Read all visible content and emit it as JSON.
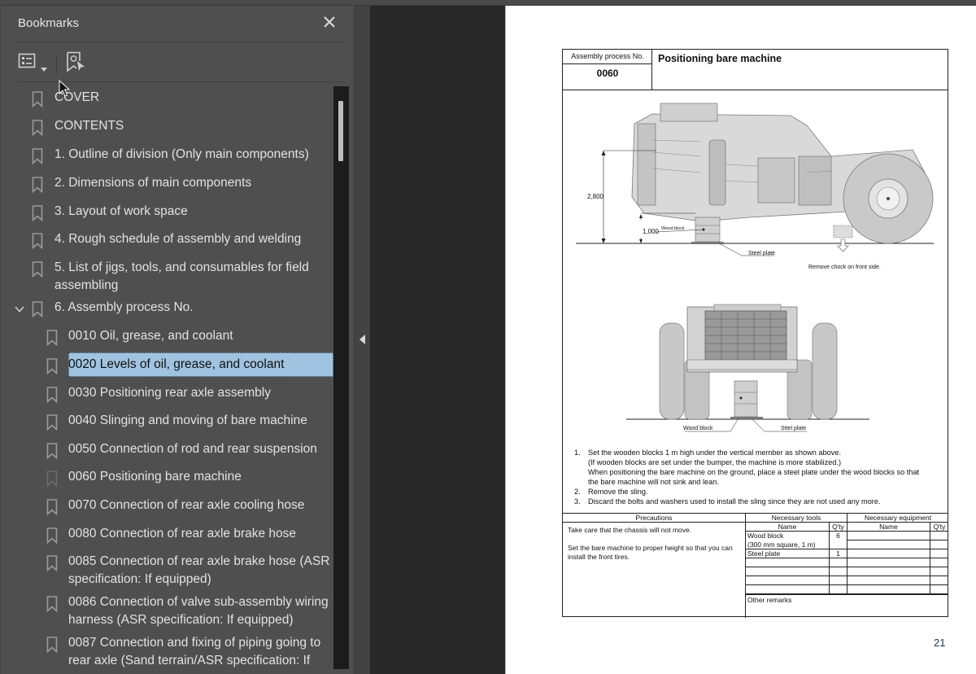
{
  "panel": {
    "title": "Bookmarks",
    "close_icon": "close-icon",
    "toolbar": {
      "options_icon": "list-options-icon",
      "options_dropdown_icon": "chevron-down-icon",
      "find_bookmark_icon": "find-current-bookmark-icon"
    }
  },
  "bookmarks": [
    {
      "label": "COVER",
      "level": 0
    },
    {
      "label": "CONTENTS",
      "level": 0
    },
    {
      "label": "1. Outline of division (Only main components)",
      "level": 0
    },
    {
      "label": "2. Dimensions of main components",
      "level": 0
    },
    {
      "label": "3. Layout of work space",
      "level": 0
    },
    {
      "label": "4. Rough schedule of assembly and welding",
      "level": 0
    },
    {
      "label": "5. List of jigs, tools, and consumables for field assembling",
      "level": 0
    },
    {
      "label": "6. Assembly process No.",
      "level": 0,
      "expanded": true
    },
    {
      "label": "0010 Oil, grease, and coolant",
      "level": 1
    },
    {
      "label": "0020 Levels of oil, grease, and coolant",
      "level": 1,
      "selected": true
    },
    {
      "label": "0030 Positioning rear axle assembly",
      "level": 1
    },
    {
      "label": "0040 Slinging and moving of bare machine",
      "level": 1
    },
    {
      "label": "0050 Connection of rod and rear suspension",
      "level": 1
    },
    {
      "label": "0060 Positioning bare machine",
      "level": 1,
      "current": true
    },
    {
      "label": "0070 Connection of rear axle cooling hose",
      "level": 1
    },
    {
      "label": "0080 Connection of rear axle brake hose",
      "level": 1
    },
    {
      "label": "0085 Connection of rear axle brake hose (ASR specification: If equipped)",
      "level": 1
    },
    {
      "label": "0086 Connection of valve sub-assembly wiring harness (ASR specification: If equipped)",
      "level": 1
    },
    {
      "label": "0087 Connection and fixing of piping going to rear axle (Sand terrain/ASR specification: If",
      "level": 1
    }
  ],
  "document": {
    "process_caption": "Assembly process No.",
    "process_number": "0060",
    "title": "Positioning bare machine",
    "figure_side": {
      "dim_total": "2,800",
      "dim_block": "1,000",
      "label_wood_block": "Wood block",
      "label_steel_plate": "Steel plate",
      "label_chock": "Remove chock on front side."
    },
    "figure_front": {
      "label_wood_block": "Wood block",
      "label_steel_plate": "Sttel plate"
    },
    "steps": [
      {
        "n": "1.",
        "lines": [
          "Set the wooden blocks 1 m high under the vertical member as shown above.",
          "(If wooden blocks are set under the bumper, the machine is more stabilized.)",
          "When positioning the bare machine on the ground, place a steel plate under the wood blocks so that",
          "the bare machine will not sink and lean."
        ]
      },
      {
        "n": "2.",
        "lines": [
          "Remove the sling."
        ]
      },
      {
        "n": "3.",
        "lines": [
          "Discard the bolts and washers used to install the sling since they are not used any more."
        ]
      }
    ],
    "table": {
      "precautions_header": "Precautions",
      "precautions": [
        "Take care that the chassis will not move.",
        "Set the bare machine to proper height so that you can install the front tires."
      ],
      "tools_header": "Necessary tools",
      "equipment_header": "Necessary equipment",
      "name_header": "Name",
      "qty_header": "Q'ty",
      "tools": [
        {
          "name": "Wood block\n(300 mm square, 1 m)",
          "qty": "6"
        },
        {
          "name": "Steel plate",
          "qty": "1"
        }
      ],
      "equipment": [],
      "other_remarks": "Other remarks"
    },
    "page_number": "21"
  }
}
